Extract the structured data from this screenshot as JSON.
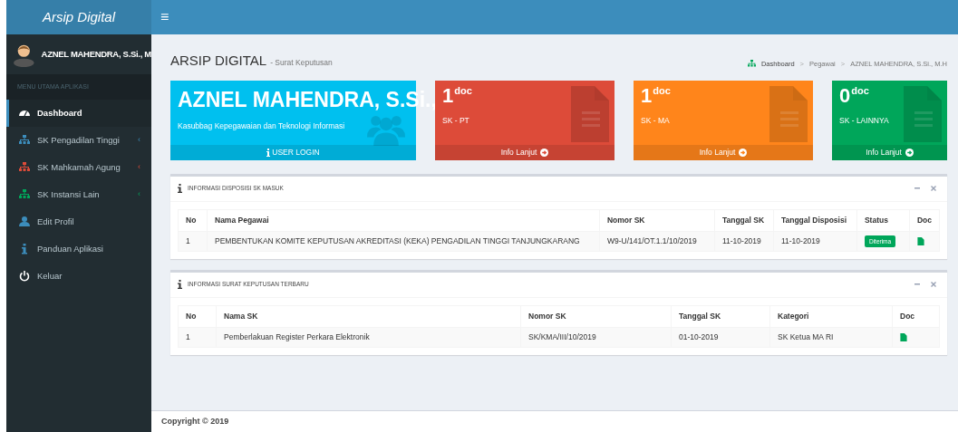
{
  "brand": "Arsip Digital",
  "toggle": "≡",
  "user": {
    "name": "AZNEL MAHENDRA, S.Si., M"
  },
  "menu_header": "MENU UTAMA APLIKASI",
  "sidebar": {
    "items": [
      {
        "label": "Dashboard",
        "kind": "dashboard",
        "selected": true
      },
      {
        "label": "SK Pengadilan Tinggi",
        "kind": "sitemap",
        "color": "#3c8dbc",
        "chevron": "‹",
        "selected": false
      },
      {
        "label": "SK Mahkamah Agung",
        "kind": "sitemap",
        "color": "#dd4b39",
        "chevron": "‹",
        "selected": false
      },
      {
        "label": "SK Instansi Lain",
        "kind": "sitemap",
        "color": "#00a65a",
        "chevron": "‹",
        "selected": false
      },
      {
        "label": "Edit Profil",
        "kind": "user",
        "selected": false
      },
      {
        "label": "Panduan Aplikasi",
        "kind": "info",
        "selected": false
      },
      {
        "label": "Keluar",
        "kind": "power",
        "selected": false
      }
    ]
  },
  "page": {
    "title": "ARSIP DIGITAL",
    "subtitle": "- Surat Keputusan"
  },
  "breadcrumb": [
    {
      "label": "Dashboard"
    },
    {
      "separator": ">",
      "label": "Pegawai"
    },
    {
      "separator": ">",
      "label": "AZNEL MAHENDRA, S.Si., M.H"
    }
  ],
  "profile_card": {
    "name": "AZNEL MAHENDRA, S.Si.,",
    "position": "Kasubbag Kepegawaian dan Teknologi Informasi",
    "footer": "USER LOGIN"
  },
  "stat_cards": [
    {
      "value": "1",
      "unit": "doc",
      "label": "SK - PT",
      "footer": "Info Lanjut",
      "color": "#dd4b39"
    },
    {
      "value": "1",
      "unit": "doc",
      "label": "SK - MA",
      "footer": "Info Lanjut",
      "color": "#ff851b"
    },
    {
      "value": "0",
      "unit": "doc",
      "label": "SK - LAINNYA",
      "footer": "Info Lanjut",
      "color": "#00a65a"
    }
  ],
  "panels": [
    {
      "title": "INFORMASI DISPOSISI SK MASUK",
      "columns": [
        "No",
        "Nama Pegawai",
        "Nomor SK",
        "Tanggal SK",
        "Tanggal Disposisi",
        "Status",
        "Doc"
      ],
      "rows": [
        [
          "1",
          "PEMBENTUKAN KOMITE KEPUTUSAN AKREDITASI (KEKA) PENGADILAN TINGGI TANJUNGKARANG",
          "W9-U/141/OT.1.1/10/2019",
          "11-10-2019",
          "11-10-2019",
          {
            "kind": "badge",
            "text": "Diterima"
          },
          {
            "kind": "doc"
          }
        ]
      ]
    },
    {
      "title": "INFORMASI SURAT KEPUTUSAN TERBARU",
      "columns": [
        "No",
        "Nama SK",
        "Nomor SK",
        "Tanggal SK",
        "Kategori",
        "Doc"
      ],
      "rows": [
        [
          "1",
          "Pemberlakuan Register Perkara Elektronik",
          "SK/KMA/III/10/2019",
          "01-10-2019",
          "SK Ketua MA RI",
          {
            "kind": "doc"
          }
        ]
      ]
    }
  ],
  "footer": "Copyright © 2019"
}
